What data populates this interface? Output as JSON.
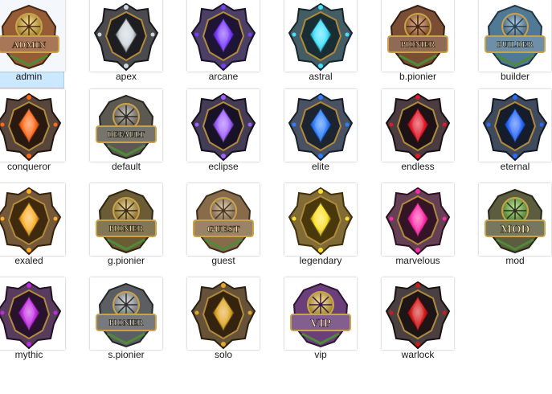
{
  "files": [
    {
      "name": "admin",
      "icon": "admin-badge-icon",
      "selected": true,
      "gem": "#ffcc33",
      "frame": "#8a4a20",
      "text": "ADMIN",
      "style": "plaque"
    },
    {
      "name": "apex",
      "icon": "apex-badge-icon",
      "selected": false,
      "gem": "#cfd6dc",
      "frame": "#2a2a30",
      "text": "",
      "style": "shield"
    },
    {
      "name": "arcane",
      "icon": "arcane-badge-icon",
      "selected": false,
      "gem": "#7a3cff",
      "frame": "#2b1d4a",
      "text": "",
      "style": "shield"
    },
    {
      "name": "astral",
      "icon": "astral-badge-icon",
      "selected": false,
      "gem": "#44e0ff",
      "frame": "#23404a",
      "text": "",
      "style": "shield"
    },
    {
      "name": "b.pionier",
      "icon": "bronze-pionier-badge-icon",
      "selected": false,
      "gem": "#d0772e",
      "frame": "#6a3a1e",
      "text": "PIONIER",
      "style": "plaque"
    },
    {
      "name": "builder",
      "icon": "builder-badge-icon",
      "selected": false,
      "gem": "#6aa0c8",
      "frame": "#3d6a8a",
      "text": "BUILDER",
      "style": "plaque"
    },
    {
      "name": "conqueror",
      "icon": "conqueror-badge-icon",
      "selected": false,
      "gem": "#ff6a1a",
      "frame": "#3a2418",
      "text": "",
      "style": "shield"
    },
    {
      "name": "default",
      "icon": "default-badge-icon",
      "selected": false,
      "gem": "#9a9080",
      "frame": "#4a463e",
      "text": "DEFAULT",
      "style": "plaque"
    },
    {
      "name": "eclipse",
      "icon": "eclipse-badge-icon",
      "selected": false,
      "gem": "#a060ff",
      "frame": "#221a36",
      "text": "",
      "style": "shield"
    },
    {
      "name": "elite",
      "icon": "elite-badge-icon",
      "selected": false,
      "gem": "#2f7fff",
      "frame": "#283446",
      "text": "",
      "style": "shield"
    },
    {
      "name": "endless",
      "icon": "endless-badge-icon",
      "selected": false,
      "gem": "#e01a2a",
      "frame": "#2a1a1e",
      "text": "",
      "style": "shield"
    },
    {
      "name": "eternal",
      "icon": "eternal-badge-icon",
      "selected": false,
      "gem": "#2a6aff",
      "frame": "#1e2a40",
      "text": "",
      "style": "shield"
    },
    {
      "name": "exaled",
      "icon": "exaled-badge-icon",
      "selected": false,
      "gem": "#ffae2a",
      "frame": "#5a3a16",
      "text": "",
      "style": "shield"
    },
    {
      "name": "g.pionier",
      "icon": "gold-pionier-badge-icon",
      "selected": false,
      "gem": "#e0b040",
      "frame": "#5a4a1e",
      "text": "PIONIER",
      "style": "plaque"
    },
    {
      "name": "guest",
      "icon": "guest-badge-icon",
      "selected": false,
      "gem": "#c8a070",
      "frame": "#7a5a36",
      "text": "GUEST",
      "style": "plaque"
    },
    {
      "name": "legendary",
      "icon": "legendary-badge-icon",
      "selected": false,
      "gem": "#ffe02a",
      "frame": "#6a5012",
      "text": "",
      "style": "shield"
    },
    {
      "name": "marvelous",
      "icon": "marvelous-badge-icon",
      "selected": false,
      "gem": "#ff2aa8",
      "frame": "#4a1e36",
      "text": "",
      "style": "shield"
    },
    {
      "name": "mod",
      "icon": "mod-badge-icon",
      "selected": false,
      "gem": "#7ad03a",
      "frame": "#4a4a2a",
      "text": "MOD",
      "style": "plaque"
    },
    {
      "name": "mythic",
      "icon": "mythic-badge-icon",
      "selected": false,
      "gem": "#c02ae0",
      "frame": "#3a1a40",
      "text": "",
      "style": "shield"
    },
    {
      "name": "s.pionier",
      "icon": "silver-pionier-badge-icon",
      "selected": false,
      "gem": "#b8bcc4",
      "frame": "#4a4c52",
      "text": "PIONIER",
      "style": "plaque"
    },
    {
      "name": "solo",
      "icon": "solo-badge-icon",
      "selected": false,
      "gem": "#e0a82a",
      "frame": "#4a3416",
      "text": "",
      "style": "shield"
    },
    {
      "name": "vip",
      "icon": "vip-badge-icon",
      "selected": false,
      "gem": "#ffd040",
      "frame": "#5a2a6a",
      "text": "VIP",
      "style": "plaque"
    },
    {
      "name": "warlock",
      "icon": "warlock-badge-icon",
      "selected": false,
      "gem": "#d01a1a",
      "frame": "#2a1e20",
      "text": "",
      "style": "shield"
    }
  ]
}
